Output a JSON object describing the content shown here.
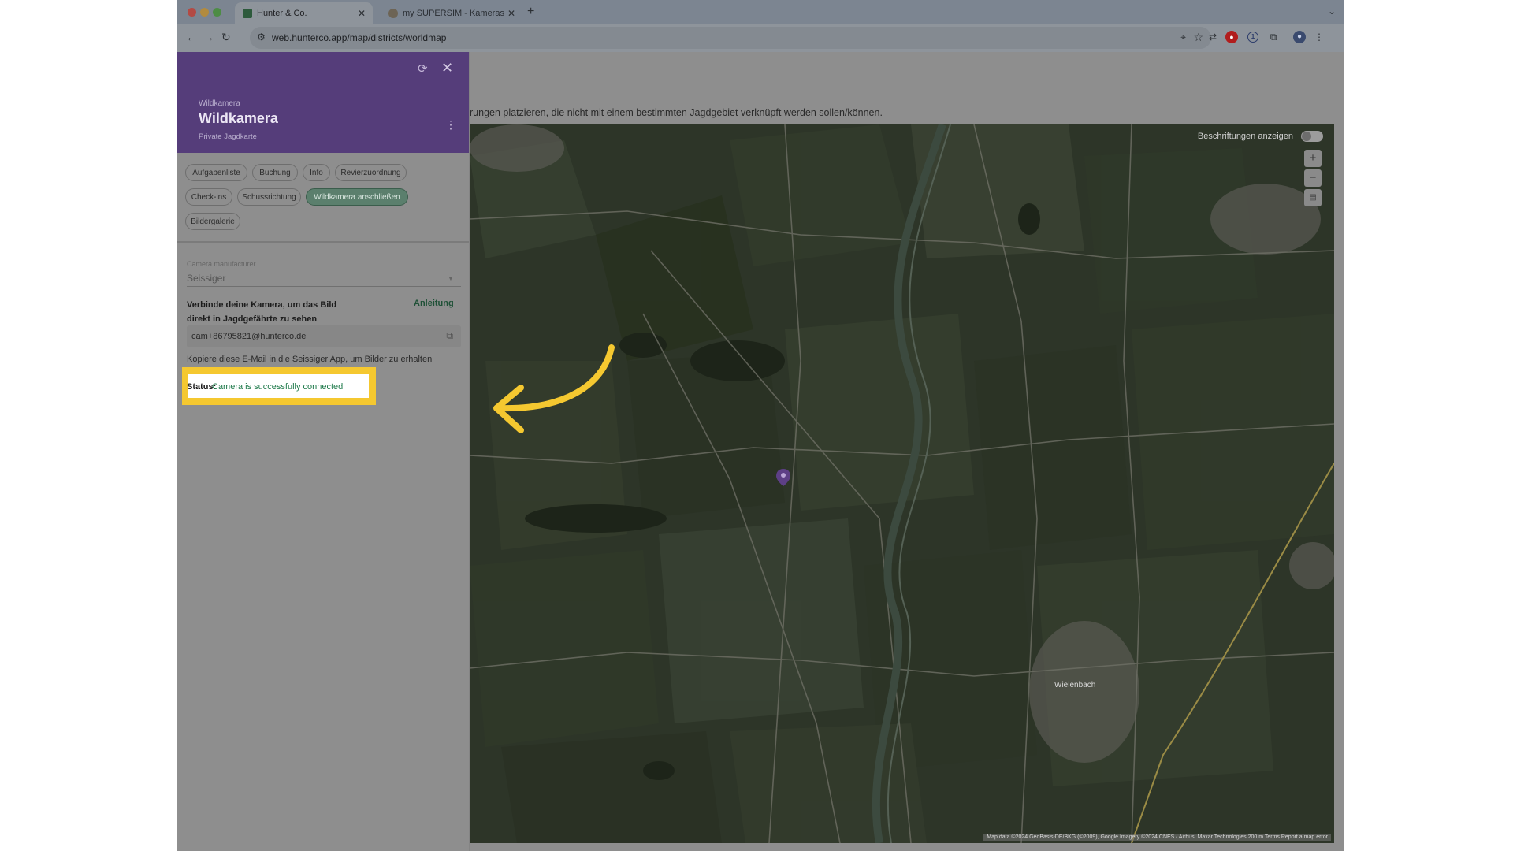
{
  "browser": {
    "tabs": [
      {
        "title": "Hunter & Co.",
        "active": true
      },
      {
        "title": "my SUPERSIM - Kameras",
        "active": false
      }
    ],
    "url": "web.hunterco.app/map/districts/worldmap"
  },
  "page": {
    "intro_text": "rungen platzieren, die nicht mit einem bestimmten Jagdgebiet verknüpft werden sollen/können."
  },
  "panel": {
    "overline": "Wildkamera",
    "title": "Wildkamera",
    "subtitle": "Private Jagdkarte",
    "header_color": "#553d7a",
    "chips": [
      {
        "label": "Aufgabenliste",
        "selected": false
      },
      {
        "label": "Buchung",
        "selected": false
      },
      {
        "label": "Info",
        "selected": false
      },
      {
        "label": "Revierzuordnung",
        "selected": false
      },
      {
        "label": "Check-ins",
        "selected": false
      },
      {
        "label": "Schussrichtung",
        "selected": false
      },
      {
        "label": "Wildkamera anschließen",
        "selected": true
      },
      {
        "label": "Bildergalerie",
        "selected": false
      }
    ],
    "manufacturer_label": "Camera manufacturer",
    "manufacturer_value": "Seissiger",
    "connect_text": "Verbinde deine Kamera, um das Bild direkt in Jagdgefährte zu sehen",
    "guide_link": "Anleitung",
    "email": "cam+86795821@hunterco.de",
    "copy_hint": "Kopiere diese E-Mail in die Seissiger App, um Bilder zu erhalten",
    "status_label": "Status:",
    "status_value": "Camera is successfully connected",
    "status_color": "#1e7a4a"
  },
  "map": {
    "labels_toggle": "Beschriftungen anzeigen",
    "labels_toggle_on": false,
    "attribution": "Map data ©2024 GeoBasis-DE/BKG (©2009), Google Imagery ©2024 CNES / Airbus, Maxar Technologies    200 m    Terms    Report a map error",
    "place_label": "Wielenbach"
  },
  "highlight_color": "#f5c830"
}
